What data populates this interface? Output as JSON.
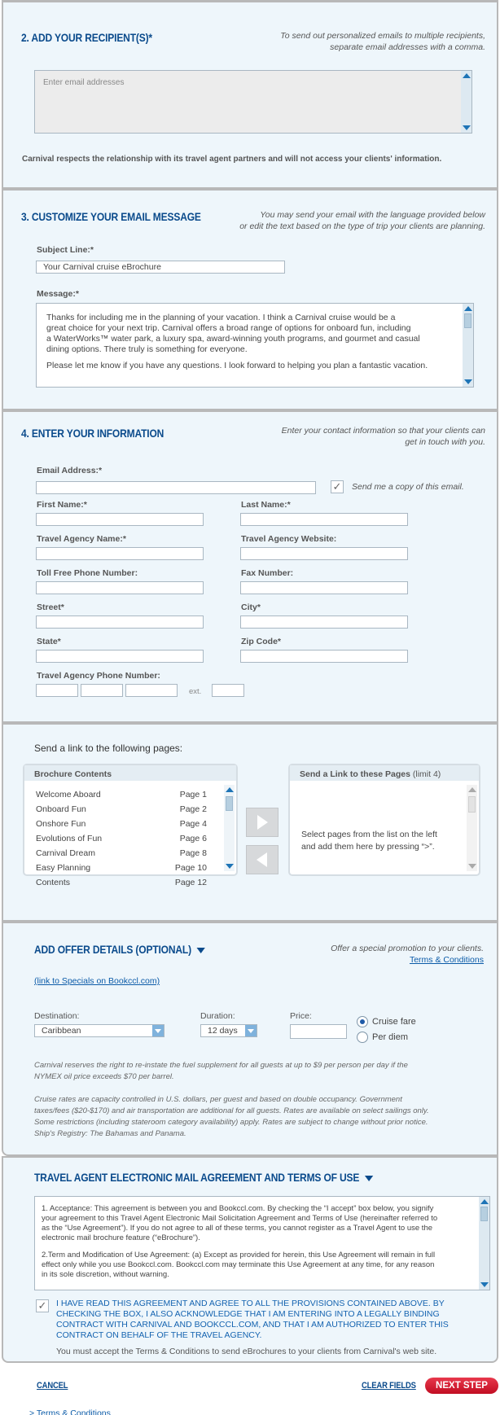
{
  "recipients": {
    "heading": "2. ADD YOUR RECIPIENT(S)*",
    "hint_line1": "To send out personalized emails to multiple recipients,",
    "hint_line2": "separate email addresses with a comma.",
    "placeholder": "Enter email addresses",
    "privacy_note": "Carnival respects the relationship with its travel agent partners and will not access your clients' information."
  },
  "customize": {
    "heading": "3. CUSTOMIZE YOUR EMAIL MESSAGE",
    "hint_line1": "You may send your email with the language provided below",
    "hint_line2": "or edit the text based on the type of trip your clients are planning.",
    "subject_label": "Subject Line:*",
    "subject_value": "Your Carnival cruise eBrochure",
    "message_label": "Message:*",
    "message_p1_l1": "Thanks for including me in the planning of your vacation. I think a Carnival cruise would be a",
    "message_p1_l2": "great choice for your next trip. Carnival offers a broad range of options for onboard fun, including",
    "message_p1_l3": "a WaterWorks™ water park, a luxury spa, award-winning youth programs, and gourmet and casual",
    "message_p1_l4": "dining options. There truly is something for everyone.",
    "message_p2": "Please let me know if you have any questions. I look forward to helping you plan a fantastic vacation."
  },
  "info": {
    "heading": "4. ENTER YOUR INFORMATION",
    "hint_line1": "Enter your contact information so that your clients can",
    "hint_line2": "get in touch with you.",
    "email_label": "Email Address:*",
    "send_copy_label": "Send me a copy of this email.",
    "send_copy_checked": true,
    "first_name_label": "First Name:*",
    "last_name_label": "Last Name:*",
    "agency_name_label": "Travel Agency Name:*",
    "agency_website_label": "Travel Agency Website:",
    "toll_free_label": "Toll Free Phone Number:",
    "fax_label": "Fax Number:",
    "street_label": "Street*",
    "city_label": "City*",
    "state_label": "State*",
    "zip_label": "Zip Code*",
    "agency_phone_label": "Travel Agency Phone Number:",
    "ext_label": "ext."
  },
  "pages": {
    "intro": "Send a link to the following pages:",
    "contents_title": "Brochure Contents",
    "items": [
      {
        "name": "Welcome Aboard",
        "page": "Page 1"
      },
      {
        "name": "Onboard Fun",
        "page": "Page 2"
      },
      {
        "name": "Onshore Fun",
        "page": "Page 4"
      },
      {
        "name": "Evolutions of Fun",
        "page": "Page 6"
      },
      {
        "name": "Carnival Dream",
        "page": "Page 8"
      },
      {
        "name": "Easy Planning",
        "page": "Page 10"
      },
      {
        "name": "Contents",
        "page": "Page 12"
      }
    ],
    "selected_title": "Send a Link to these Pages",
    "selected_limit": "(limit 4)",
    "selected_hint_l1": "Select pages from the list on the left",
    "selected_hint_l2": "and add them here by pressing “>”."
  },
  "offer": {
    "heading": "ADD OFFER DETAILS (OPTIONAL)",
    "hint": "Offer a special promotion to your clients.",
    "terms_link": "Terms & Conditions",
    "specials_link": "(link to Specials on Bookccl.com)",
    "destination_label": "Destination:",
    "destination_value": "Caribbean",
    "duration_label": "Duration:",
    "duration_value": "12 days",
    "price_label": "Price:",
    "cruise_fare": "Cruise fare",
    "per_diem": "Per diem",
    "fuel_l1": "Carnival reserves the right to re-instate the fuel supplement for all guests at up to $9 per person per day if the",
    "fuel_l2": "NYMEX oil price exceeds $70 per barrel.",
    "rates_l1": "Cruise rates are capacity controlled in U.S. dollars, per guest and based on double occupancy. Government",
    "rates_l2": "taxes/fees ($20-$170) and air transportation are additional for all guests. Rates are available on select sailings only.",
    "rates_l3": "Some restrictions (including stateroom category availability) apply. Rates are subject to change without prior notice.",
    "rates_l4": "Ship's Registry: The Bahamas and Panama."
  },
  "agreement": {
    "heading": "TRAVEL AGENT ELECTRONIC MAIL AGREEMENT AND TERMS OF USE",
    "p1_l1": "1. Acceptance: This agreement is between you and Bookccl.com. By checking the “I accept” box below, you signify",
    "p1_l2": "your agreement to this Travel Agent Electronic Mail Solicitation Agreement and Terms of Use (hereinafter referred to",
    "p1_l3": "as the “Use Agreement”).  If you do not agree to all of these terms, you cannot register as a Travel Agent to use the",
    "p1_l4": "electronic mail brochure feature (“eBrochure”).",
    "p2_l1": "2.Term and Modification of Use Agreement: (a) Except as provided for herein, this Use Agreement will remain in full",
    "p2_l2": "effect only while you use Bookccl.com. Bookccl.com may terminate this Use Agreement at any time, for any reason",
    "p2_l3": "in its sole discretion, without warning.",
    "accept_l1": "I HAVE READ THIS AGREEMENT AND AGREE TO ALL THE PROVISIONS CONTAINED ABOVE. BY",
    "accept_l2": "CHECKING THE BOX, I ALSO ACKNOWLEDGE THAT I AM ENTERING INTO A LEGALLY BINDING",
    "accept_l3": "CONTRACT WITH CARNIVAL AND BOOKCCL.COM, AND THAT I AM AUTHORIZED TO ENTER THIS",
    "accept_l4": "CONTRACT ON BEHALF OF THE TRAVEL AGENCY.",
    "accept_checked": true,
    "must_accept": "You must accept the Terms & Conditions to send eBrochures to your clients from Carnival's web site."
  },
  "footer": {
    "cancel": "CANCEL",
    "clear": "CLEAR FIELDS",
    "next": "NEXT STEP",
    "terms_link": "> Terms & Conditions"
  },
  "colors": {
    "accent": "#0b4b8c",
    "panel": "#eef6fb",
    "next_button": "#d4122a"
  }
}
